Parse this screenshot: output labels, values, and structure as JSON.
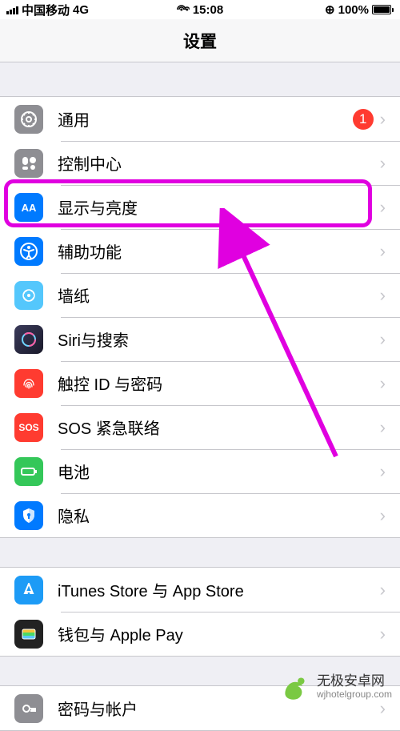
{
  "status": {
    "carrier": "中国移动",
    "network": "4G",
    "time": "15:08",
    "battery_pct": "100%"
  },
  "nav": {
    "title": "设置"
  },
  "sections": [
    {
      "rows": [
        {
          "label": "通用",
          "icon": "general",
          "bg": "#8e8e93",
          "badge": "1"
        },
        {
          "label": "控制中心",
          "icon": "control",
          "bg": "#8e8e93"
        },
        {
          "label": "显示与亮度",
          "icon": "display",
          "bg": "#007aff"
        },
        {
          "label": "辅助功能",
          "icon": "accessibility",
          "bg": "#007aff"
        },
        {
          "label": "墙纸",
          "icon": "wallpaper",
          "bg": "#54c7fc"
        },
        {
          "label": "Siri与搜索",
          "icon": "siri",
          "bg": "#222"
        },
        {
          "label": "触控 ID 与密码",
          "icon": "touchid",
          "bg": "#ff3b30"
        },
        {
          "label": "SOS 紧急联络",
          "icon": "sos",
          "bg": "#ff3b30",
          "text_icon": "SOS"
        },
        {
          "label": "电池",
          "icon": "battery",
          "bg": "#34c759"
        },
        {
          "label": "隐私",
          "icon": "privacy",
          "bg": "#007aff"
        }
      ]
    },
    {
      "rows": [
        {
          "label": "iTunes Store 与 App Store",
          "icon": "appstore",
          "bg": "#1d9bf6"
        },
        {
          "label": "钱包与 Apple Pay",
          "icon": "wallet",
          "bg": "#222"
        }
      ]
    },
    {
      "rows": [
        {
          "label": "密码与帐户",
          "icon": "passwords",
          "bg": "#8e8e93"
        }
      ]
    }
  ],
  "annotation": {
    "highlight_row_index": 2,
    "arrow_color": "#e000e0"
  },
  "watermark": {
    "main": "无极安卓网",
    "sub": "wjhotelgroup.com"
  }
}
